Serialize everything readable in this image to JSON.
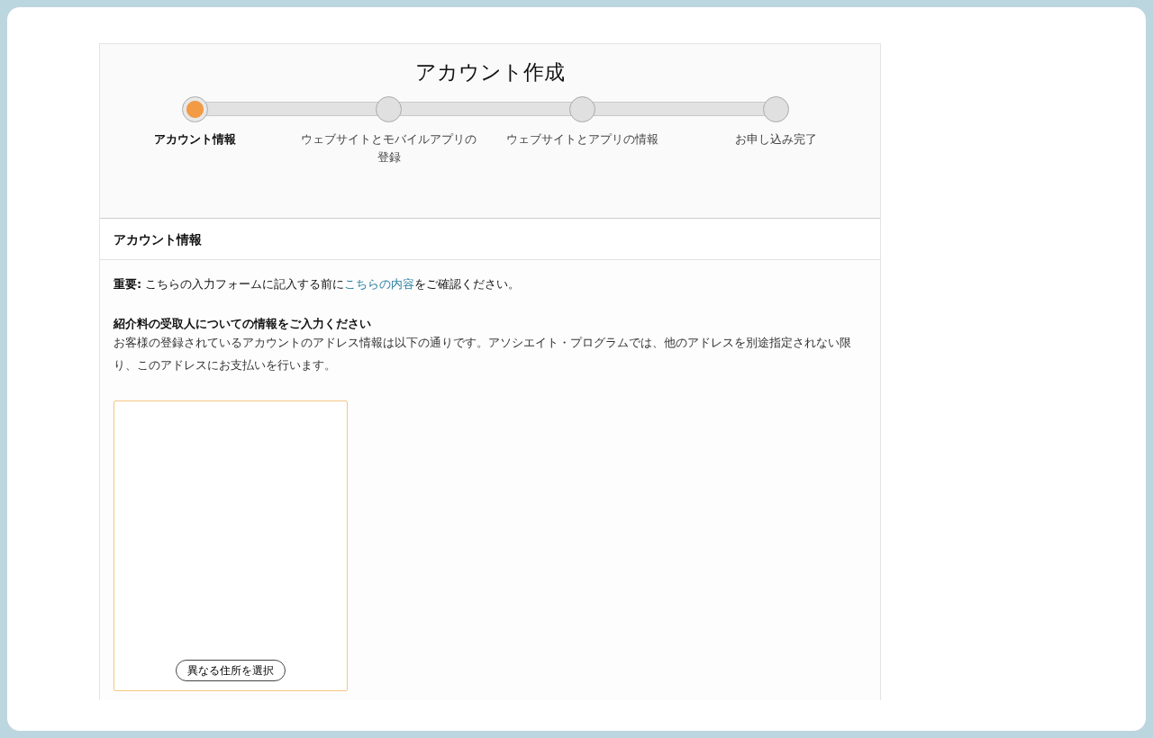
{
  "title": "アカウント作成",
  "steps": [
    {
      "label": "アカウント情報",
      "current": true
    },
    {
      "label": "ウェブサイトとモバイルアプリの登録",
      "current": false
    },
    {
      "label": "ウェブサイトとアプリの情報",
      "current": false
    },
    {
      "label": "お申し込み完了",
      "current": false
    }
  ],
  "section": {
    "heading": "アカウント情報",
    "notice": {
      "label": "重要:",
      "text_before": "こちらの入力フォームに記入する前に",
      "link": "こちらの内容",
      "text_after": "をご確認ください。"
    },
    "subheading": "紹介料の受取人についての情報をご入力ください",
    "description": "お客様の登録されているアカウントのアドレス情報は以下の通りです。アソシエイト・プログラムでは、他のアドレスを別途指定されない限り、このアドレスにお支払いを行います。",
    "address_card": {
      "button": "異なる住所を選択"
    }
  }
}
